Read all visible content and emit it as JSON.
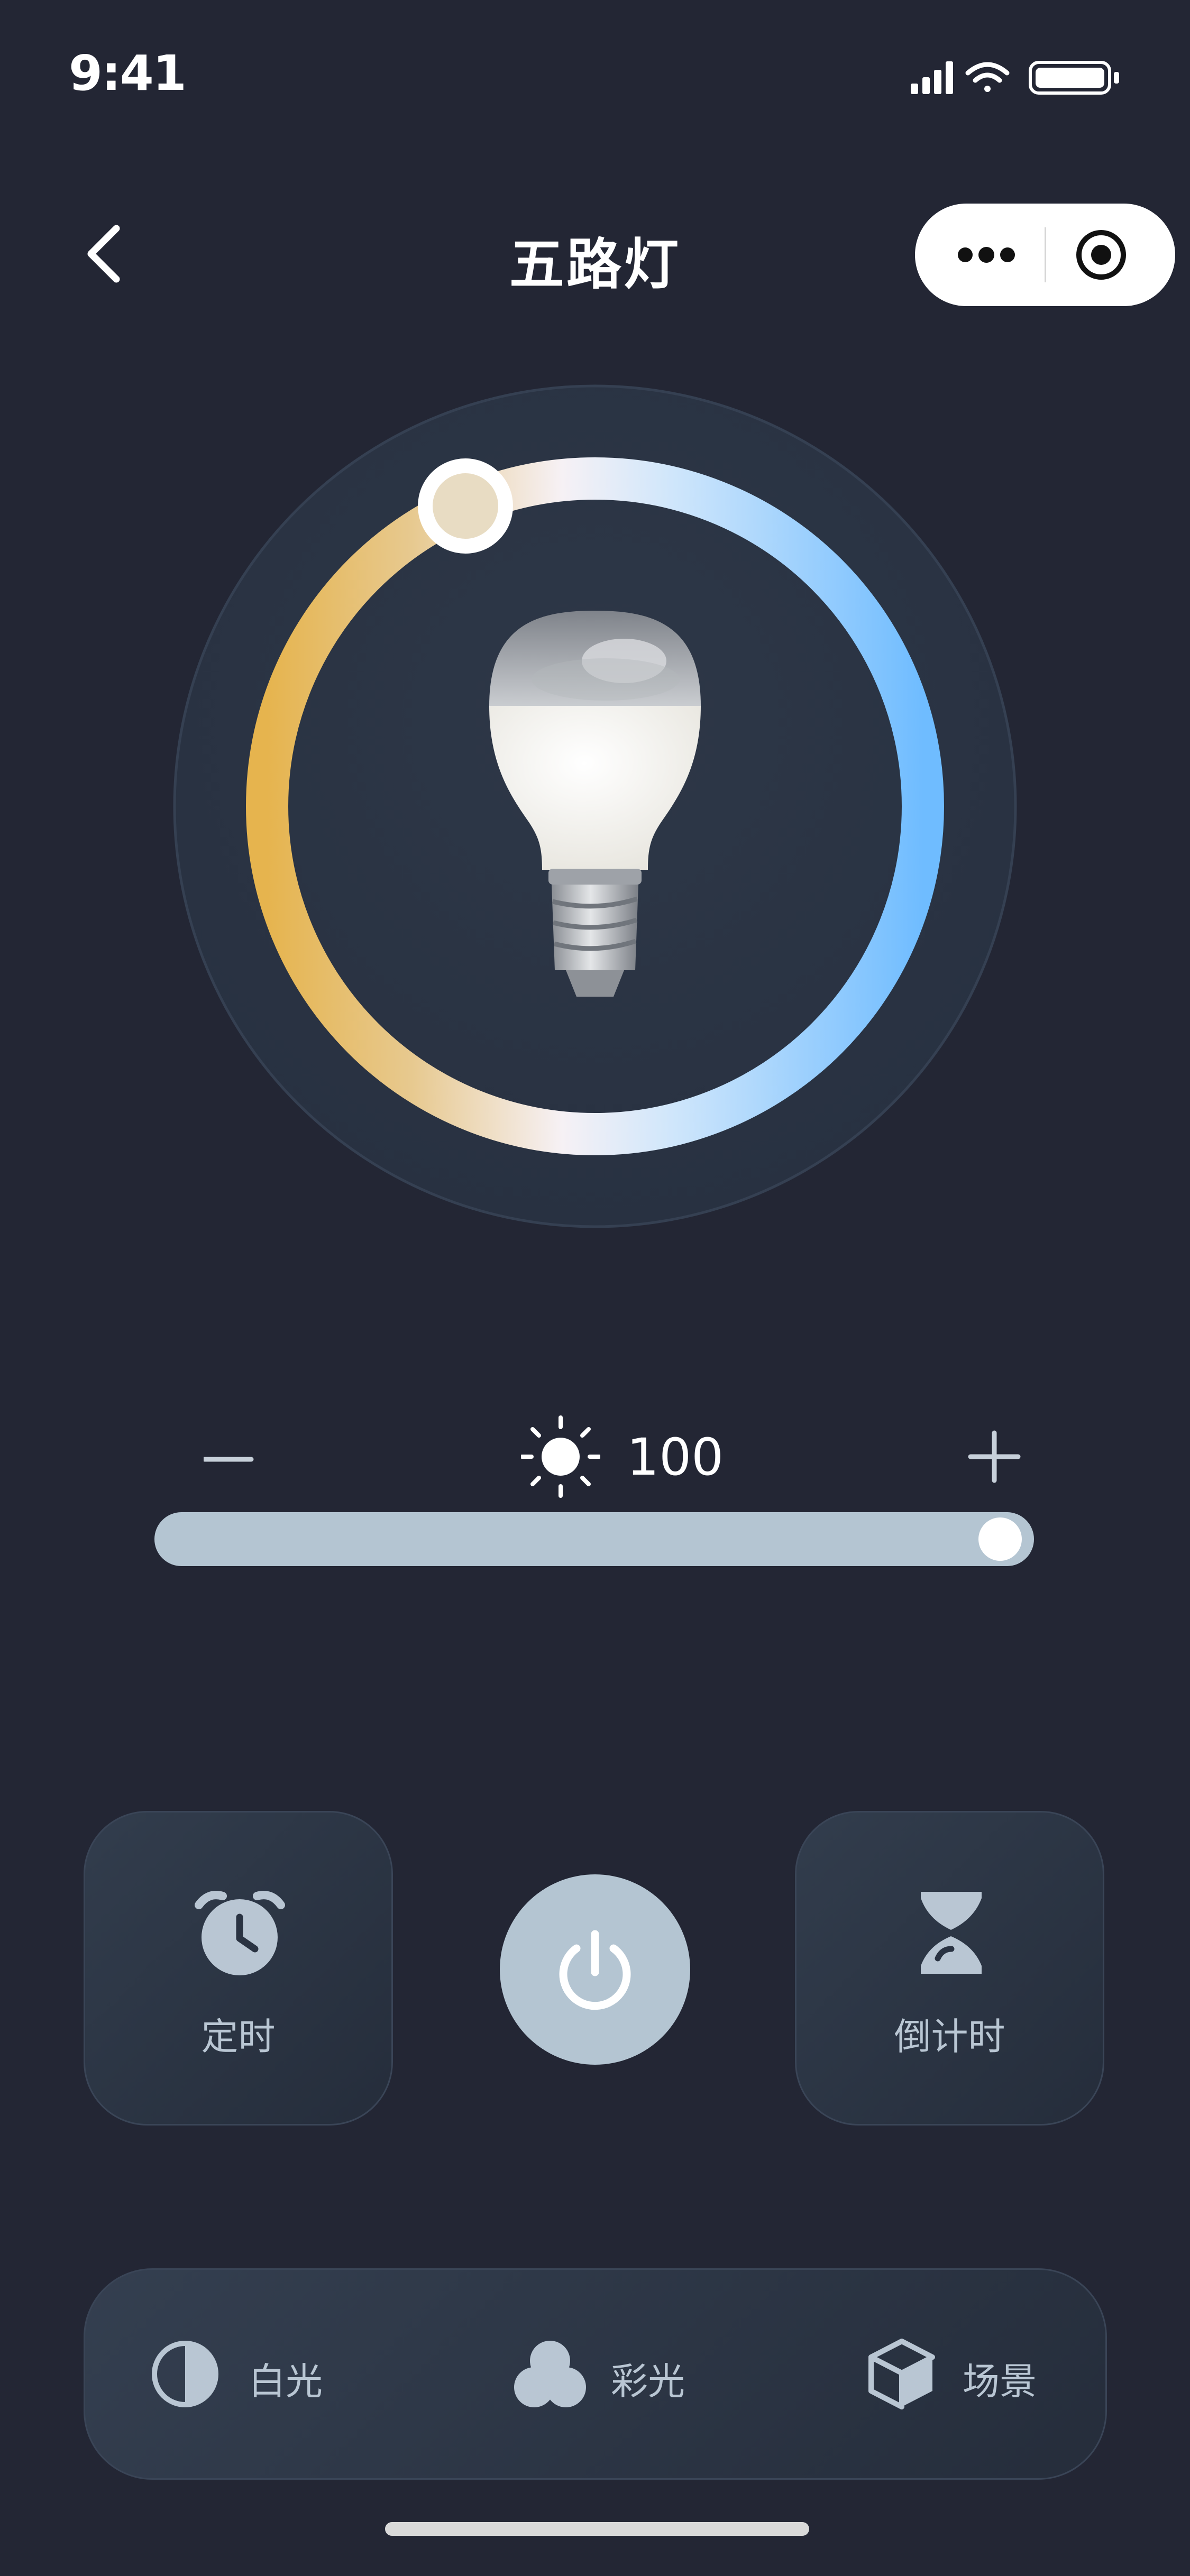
{
  "status_bar": {
    "time": "9:41"
  },
  "nav": {
    "title": "五路灯"
  },
  "brightness": {
    "value": "100",
    "level": 1.0
  },
  "color_temperature": {
    "level": 0.0
  },
  "controls": {
    "timer_label": "定时",
    "countdown_label": "倒计时"
  },
  "tabs": [
    {
      "label": "白光",
      "icon": "half-circle-icon"
    },
    {
      "label": "彩光",
      "icon": "color-circles-icon"
    },
    {
      "label": "场景",
      "icon": "cube-icon"
    }
  ],
  "colors": {
    "background": "#232634",
    "accent_slider": "#b4c5d2",
    "warm": "#e6b44e",
    "cool": "#6fbcff"
  }
}
